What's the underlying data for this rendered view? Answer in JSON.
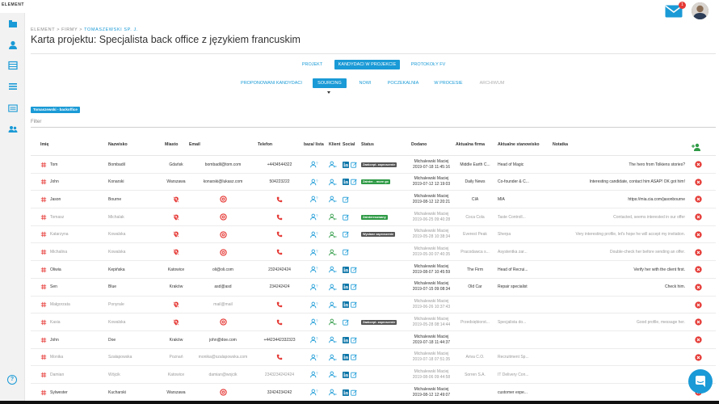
{
  "app": {
    "logo_prefix": "",
    "logo_name": "ELEMENT"
  },
  "header": {
    "mail_badge": "1"
  },
  "breadcrumb": {
    "prefix": "ELEMENT > FIRMY > ",
    "last": "TOMASZEWSKI SP. J."
  },
  "page": {
    "title": "Karta projektu: Specjalista back office z językiem francuskim"
  },
  "tabs_primary": [
    {
      "label": "PROJEKT",
      "active": false
    },
    {
      "label": "KANDYDACI W PROJEKCIE",
      "active": true
    },
    {
      "label": "PROTOKOŁY FV",
      "active": false
    }
  ],
  "tabs_secondary": [
    {
      "label": "PROPONOWANI KANDYDACI",
      "active": false
    },
    {
      "label": "SOURCING",
      "active": true
    },
    {
      "label": "NOWI",
      "active": false
    },
    {
      "label": "POCZEKALNIA",
      "active": false
    },
    {
      "label": "W PROCESIE",
      "active": false
    },
    {
      "label": "ARCHIWUM",
      "active": false,
      "disabled": true
    }
  ],
  "tag": "Tomaszewski - backoffice",
  "filter": {
    "placeholder": "Filter"
  },
  "table": {
    "headers": [
      "Imię",
      "Nazwisko",
      "Miasto",
      "Email",
      "Telefon",
      "baza/ lista",
      "Klient",
      "Social",
      "Status",
      "Dodano",
      "Aktualna firma",
      "Aktualne stanowisko",
      "Notatka"
    ],
    "rows": [
      {
        "imie": "Tom",
        "nazwisko": "Bombadil",
        "miasto": "Gdańsk",
        "email": "bombadil@tom.com",
        "telefon": "+4434544322",
        "linkedin": true,
        "status": "Zaakcept. zaproszenie",
        "status_color": "dark",
        "dodano_by": "Michalewski Maciej",
        "dodano_at": "2019-07-18 11:45:16",
        "firma": "Middle Earth C...",
        "stanowisko": "Head of Magic",
        "notatka": "The hero from Tolkiens stories?",
        "dim": false
      },
      {
        "imie": "John",
        "nazwisko": "Konarski",
        "miasto": "Warszawa",
        "email": "konarski@lukasz.com",
        "telefon": "504223222",
        "linkedin": true,
        "status": "Zainter. - more go",
        "status_color": "green",
        "dodano_by": "Michalewski Maciej",
        "dodano_at": "2019-07-12 12:19:03",
        "firma": "Daily News",
        "stanowisko": "Co-founder & C...",
        "notatka": "Interesting candidate, contact him ASAP! OK got him!",
        "dim": false
      },
      {
        "imie": "Jason",
        "nazwisko": "Bourne",
        "miasto": "",
        "email": "",
        "telefon": "",
        "linkedin": false,
        "status": "",
        "status_color": "",
        "dodano_by": "Michalewski Maciej",
        "dodano_at": "2019-08-12 12:20:21",
        "firma": "CIA",
        "stanowisko": "MIA",
        "notatka": "https://mia.cia.com/jasonbourne",
        "dim": false
      },
      {
        "imie": "Tomasz",
        "nazwisko": "Michalak",
        "miasto": "",
        "email": "",
        "telefon": "",
        "linkedin": false,
        "status": "Zainteresowany",
        "status_color": "green",
        "dodano_by": "Michalewski Maciej",
        "dodano_at": "2019-06-25 09:40:28",
        "firma": "Coca Cola",
        "stanowisko": "Taste Controll...",
        "notatka": "Contacted, seems interested in our offer",
        "dim": true
      },
      {
        "imie": "Katarzyna",
        "nazwisko": "Kowalska",
        "miasto": "",
        "email": "",
        "telefon": "",
        "linkedin": false,
        "status": "Wysłane zaproszenie",
        "status_color": "dark",
        "dodano_by": "Michalewski Maciej",
        "dodano_at": "2019-05-28 10:38:34",
        "firma": "Everest Peak",
        "stanowisko": "Sherpa",
        "notatka": "Very interesting profile, let's hope he will accept my invitation.",
        "dim": true
      },
      {
        "imie": "Michalina",
        "nazwisko": "Kowalska",
        "miasto": "",
        "email": "",
        "telefon": "",
        "linkedin": false,
        "status": "",
        "status_color": "",
        "dodano_by": "Michalewski Maciej",
        "dodano_at": "2019-05-30 07:40:35",
        "firma": "Pracodawca s...",
        "stanowisko": "Asystentka zar...",
        "notatka": "Double-check her before sending an offer.",
        "dim": true
      },
      {
        "imie": "Oliwia",
        "nazwisko": "Kepińska",
        "miasto": "Katowice",
        "email": "oli@oli.com",
        "telefon": "2324242424",
        "linkedin": true,
        "status": "",
        "status_color": "",
        "dodano_by": "Michalewski Maciej",
        "dodano_at": "2019-08-07 10:45:59",
        "firma": "The Firm",
        "stanowisko": "Head of Recrui...",
        "notatka": "Verify her with the client first.",
        "dim": false
      },
      {
        "imie": "Sen",
        "nazwisko": "Blue",
        "miasto": "Kraków",
        "email": "asd@asd",
        "telefon": "234242424",
        "linkedin": true,
        "status": "",
        "status_color": "",
        "dodano_by": "Michalewski Maciej",
        "dodano_at": "2019-07-15 09:08:34",
        "firma": "Old Car",
        "stanowisko": "Repair specialist",
        "notatka": "Check him.",
        "dim": false
      },
      {
        "imie": "Małgorzata",
        "nazwisko": "Ponyrale",
        "miasto": "",
        "email": "mail@mail",
        "telefon": "",
        "linkedin": true,
        "status": "",
        "status_color": "",
        "dodano_by": "Michalewski Maciej",
        "dodano_at": "2019-06-26 10:37:43",
        "firma": "",
        "stanowisko": "",
        "notatka": "",
        "dim": true
      },
      {
        "imie": "Kasia",
        "nazwisko": "Kowalska",
        "miasto": "",
        "email": "",
        "telefon": "",
        "linkedin": false,
        "status": "Zaakcept. zaproszenie",
        "status_color": "dark",
        "dodano_by": "Michalewski Maciej",
        "dodano_at": "2019-05-28 08:14:44",
        "firma": "Przedsiębiorst...",
        "stanowisko": "Specjalista do...",
        "notatka": "Good profile, message her.",
        "dim": true
      },
      {
        "imie": "John",
        "nazwisko": "Doe",
        "miasto": "Kraków",
        "email": "john@doe.com",
        "telefon": "+4423442332323",
        "linkedin": true,
        "status": "",
        "status_color": "",
        "dodano_by": "Michalewski Maciej",
        "dodano_at": "2019-07-18 11:44:37",
        "firma": "",
        "stanowisko": "",
        "notatka": "",
        "dim": false
      },
      {
        "imie": "Monika",
        "nazwisko": "Szałapowska",
        "miasto": "Poznań",
        "email": "monika@szalapowska.com",
        "telefon": "",
        "linkedin": true,
        "status": "",
        "status_color": "",
        "dodano_by": "Michalewski Maciej",
        "dodano_at": "2019-07-18 07:51:35",
        "firma": "Ariva C.O.",
        "stanowisko": "Recruitment Sp...",
        "notatka": "",
        "dim": true
      },
      {
        "imie": "Damian",
        "nazwisko": "Wójcik",
        "miasto": "Katowice",
        "email": "damian@wojcik",
        "telefon": "2343234242424",
        "linkedin": true,
        "status": "",
        "status_color": "",
        "dodano_by": "Michalewski Maciej",
        "dodano_at": "2019-08-06 09:44:58",
        "firma": "Sorren S.A.",
        "stanowisko": "IT Delivery Con...",
        "notatka": "",
        "dim": true
      },
      {
        "imie": "Sylwester",
        "nazwisko": "Kucharski",
        "miasto": "Warszawa",
        "email": "",
        "telefon": "32424234242",
        "linkedin": true,
        "status": "",
        "status_color": "",
        "dodano_by": "Michalewski Maciej",
        "dodano_at": "2019-08-12 12:49:07",
        "firma": "",
        "stanowisko": "customer expe...",
        "notatka": "",
        "dim": false
      }
    ]
  },
  "help_label": "?",
  "colors": {
    "accent": "#1a9ad6",
    "danger": "#e53935",
    "icon_red": "#e53935",
    "linkedin": "#0e76a8",
    "status_dark": "#555555",
    "status_green": "#2e9a45"
  }
}
